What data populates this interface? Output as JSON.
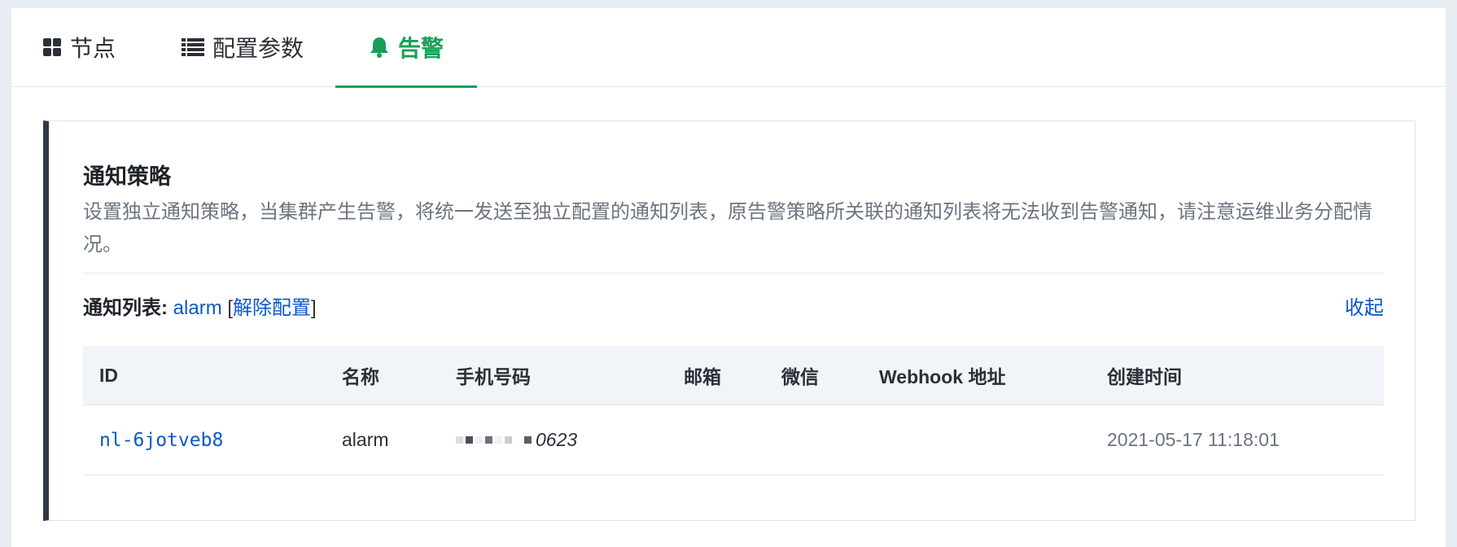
{
  "tabs": [
    {
      "label": "节点",
      "icon": "grid-icon",
      "active": false
    },
    {
      "label": "配置参数",
      "icon": "list-icon",
      "active": false
    },
    {
      "label": "告警",
      "icon": "bell-icon",
      "active": true
    }
  ],
  "colors": {
    "accent": "#1a9e58",
    "link": "#0b57c8",
    "card_border_left": "#2d3947"
  },
  "card": {
    "title": "通知策略",
    "description": "设置独立通知策略，当集群产生告警，将统一发送至独立配置的通知列表，原告警策略所关联的通知列表将无法收到告警通知，请注意运维业务分配情况。",
    "list_label": "通知列表:",
    "list_value": "alarm",
    "bracket_open": "[",
    "unbind_label": "解除配置",
    "bracket_close": "]",
    "collapse_label": "收起"
  },
  "table": {
    "columns": [
      "ID",
      "名称",
      "手机号码",
      "邮箱",
      "微信",
      "Webhook 地址",
      "创建时间"
    ],
    "rows": [
      {
        "id": "nl-6jotveb8",
        "name": "alarm",
        "phone_visible": "0623",
        "email": "",
        "wechat": "",
        "webhook": "",
        "created": "2021-05-17 11:18:01"
      }
    ]
  }
}
